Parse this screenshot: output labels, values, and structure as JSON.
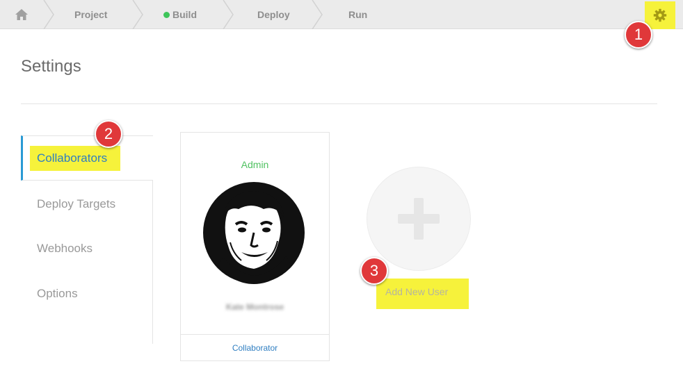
{
  "breadcrumb": {
    "home_icon": "home-icon",
    "items": [
      {
        "label": "Project"
      },
      {
        "label": "Build",
        "status_color": "#3ec55a"
      },
      {
        "label": "Deploy"
      },
      {
        "label": "Run"
      }
    ],
    "settings_icon": "gear-icon"
  },
  "page": {
    "title": "Settings"
  },
  "sidebar": {
    "items": [
      {
        "label": "Collaborators",
        "active": true
      },
      {
        "label": "Deploy Targets"
      },
      {
        "label": "Webhooks"
      },
      {
        "label": "Options"
      }
    ]
  },
  "collaborator_card": {
    "role": "Admin",
    "name": "Kate Montrose",
    "link": "Collaborator"
  },
  "add_user": {
    "icon": "plus-icon",
    "label": "Add New User"
  },
  "callouts": [
    "1",
    "2",
    "3"
  ],
  "colors": {
    "highlight": "#f6f23b",
    "accent": "#2f7ec1",
    "status_green": "#3ec55a",
    "callout_red": "#e0383a"
  }
}
